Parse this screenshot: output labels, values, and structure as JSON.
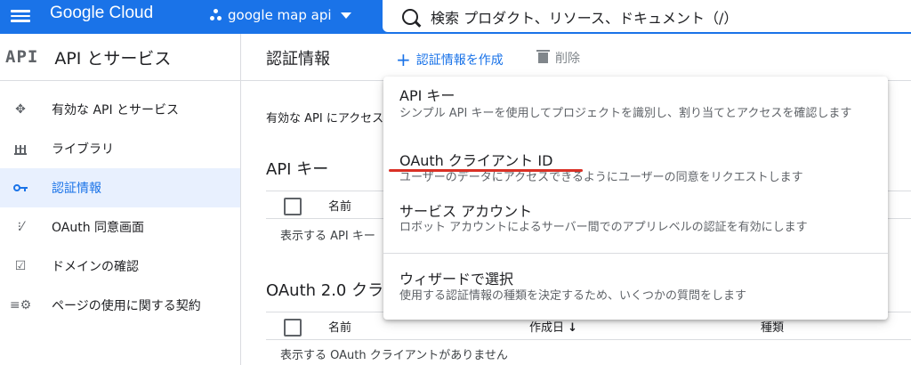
{
  "topbar": {
    "logo": "Google Cloud",
    "project": "google map api",
    "search_text": "検索  プロダクト、リソース、ドキュメント（/）"
  },
  "nav": {
    "api_logo": "API",
    "title": "API とサービス",
    "items": [
      {
        "label": "有効な API とサービス",
        "icon": "enabled-apis-icon"
      },
      {
        "label": "ライブラリ",
        "icon": "library-icon"
      },
      {
        "label": "認証情報",
        "icon": "key-icon",
        "active": true
      },
      {
        "label": "OAuth 同意画面",
        "icon": "consent-icon"
      },
      {
        "label": "ドメインの確認",
        "icon": "domain-check-icon"
      },
      {
        "label": "ページの使用に関する契約",
        "icon": "settings-list-icon"
      }
    ]
  },
  "main": {
    "title": "認証情報",
    "create_label": "認証情報を作成",
    "delete_label": "削除",
    "description": "有効な API にアクセス",
    "api_keys": {
      "title": "API キー",
      "col_name": "名前",
      "empty": "表示する API キー"
    },
    "oauth": {
      "title": "OAuth 2.0 クラ",
      "col_name": "名前",
      "col_created": "作成日",
      "col_type": "種類",
      "empty": "表示する OAuth クライアントがありません"
    }
  },
  "menu": {
    "items": [
      {
        "title": "API キー",
        "desc": "シンプル API キーを使用してプロジェクトを識別し、割り当てとアクセスを確認します"
      },
      {
        "title": "OAuth クライアント ID",
        "desc": "ユーザーのデータにアクセスできるようにユーザーの同意をリクエストします"
      },
      {
        "title": "サービス アカウント",
        "desc": "ロボット アカウントによるサーバー間でのアプリレベルの認証を有効にします"
      },
      {
        "title": "ウィザードで選択",
        "desc": "使用する認証情報の種類を決定するため、いくつかの質問をします"
      }
    ]
  },
  "colors": {
    "brand": "#1a73e8",
    "active_bg": "#e8f0fe",
    "highlight": "#d93025"
  }
}
